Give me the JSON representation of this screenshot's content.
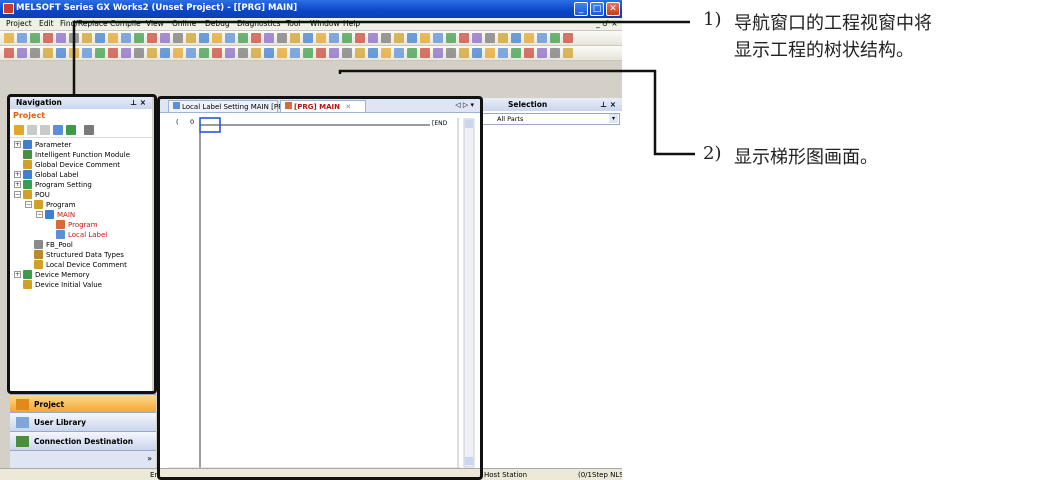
{
  "window": {
    "title": "MELSOFT Series GX Works2 (Unset Project) - [[PRG] MAIN]",
    "controls": [
      "_",
      "□",
      "✕"
    ]
  },
  "menubar": {
    "items": [
      "Project",
      "Edit",
      "Find/Replace",
      "Compile",
      "View",
      "Online",
      "Debug",
      "Diagnostics",
      "Tool",
      "Window",
      "Help"
    ],
    "right": "_ ♂ ×"
  },
  "navigation": {
    "title": "Navigation",
    "pin": "⊥ ×",
    "section": "Project",
    "tree": [
      {
        "label": "Parameter",
        "level": 0,
        "exp": "+"
      },
      {
        "label": "Intelligent Function Module",
        "level": 0,
        "exp": ""
      },
      {
        "label": "Global Device Comment",
        "level": 0,
        "exp": ""
      },
      {
        "label": "Global Label",
        "level": 0,
        "exp": "+"
      },
      {
        "label": "Program Setting",
        "level": 0,
        "exp": "+"
      },
      {
        "label": "POU",
        "level": 0,
        "exp": "−"
      },
      {
        "label": "Program",
        "level": 1,
        "exp": "−"
      },
      {
        "label": "MAIN",
        "level": 2,
        "exp": "−",
        "red": true
      },
      {
        "label": "Program",
        "level": 3,
        "exp": "",
        "red": true
      },
      {
        "label": "Local Label",
        "level": 3,
        "exp": "",
        "red": true
      },
      {
        "label": "FB_Pool",
        "level": 1,
        "exp": ""
      },
      {
        "label": "Structured Data Types",
        "level": 1,
        "exp": ""
      },
      {
        "label": "Local Device Comment",
        "level": 1,
        "exp": ""
      },
      {
        "label": "Device Memory",
        "level": 0,
        "exp": "+"
      },
      {
        "label": "Device Initial Value",
        "level": 0,
        "exp": ""
      }
    ]
  },
  "docks": {
    "project": "Project",
    "user_library": "User Library",
    "connection_destination": "Connection Destination",
    "more": "»"
  },
  "editor": {
    "tab1": "Local Label Setting MAIN [PRG]",
    "tab2": "[PRG] MAIN",
    "tab2_close": "✕",
    "tab_nav": "◁ ▷ ▾",
    "row_step": "0",
    "row_bracket": "(",
    "end_label": "[END"
  },
  "selection_panel": {
    "title": "Selection",
    "pin": "⊥ ×",
    "dropdown": "All Parts"
  },
  "statusbar": {
    "left": "En",
    "station": "Host Station",
    "steps": "(0/1Step NLS"
  },
  "callouts": {
    "note1_num": "1)",
    "note1_line1": "导航窗口的工程视窗中将",
    "note1_line2": "显示工程的树状结构。",
    "note2_num": "2)",
    "note2_line1": "显示梯形图画面。"
  },
  "colors": {
    "title_bar": "#0a46c8",
    "project_accent": "#e06010",
    "active_dock": "#f0a030",
    "tree_red": "#d01010"
  }
}
